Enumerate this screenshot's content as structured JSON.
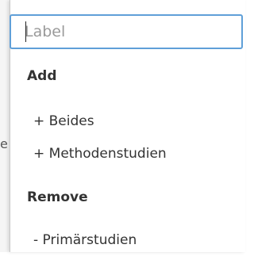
{
  "label_input": {
    "placeholder": "Label",
    "value": ""
  },
  "background": {
    "fragment": "e"
  },
  "menu": {
    "groups": [
      {
        "header": "Add",
        "items": [
          "+ Beides",
          "+ Methodenstudien"
        ]
      },
      {
        "header": "Remove",
        "items": [
          "- Primärstudien"
        ]
      }
    ]
  },
  "colors": {
    "input_border": "#5f9fd8",
    "text": "#333333",
    "placeholder": "#9a9a9a"
  }
}
